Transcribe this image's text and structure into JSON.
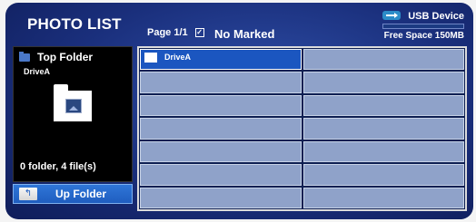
{
  "header": {
    "title": "PHOTO LIST",
    "page_info": "Page 1/1",
    "marked_text": "No Marked",
    "device_label": "USB Device",
    "free_space": "Free Space 150MB",
    "usage_fraction": 0.0
  },
  "left_panel": {
    "folder_title": "Top Folder",
    "drive_name": "DriveA",
    "file_count": "0 folder, 4 file(s)",
    "up_folder_label": "Up Folder",
    "icons": [
      "folder-small-icon",
      "big-folder-icon",
      "up-arrow-icon"
    ]
  },
  "grid": {
    "rows": 7,
    "columns": 2,
    "items": [
      {
        "label": "DriveA",
        "selected": true
      },
      {
        "label": "",
        "selected": false
      },
      {
        "label": "",
        "selected": false
      },
      {
        "label": "",
        "selected": false
      },
      {
        "label": "",
        "selected": false
      },
      {
        "label": "",
        "selected": false
      },
      {
        "label": "",
        "selected": false
      },
      {
        "label": "",
        "selected": false
      },
      {
        "label": "",
        "selected": false
      },
      {
        "label": "",
        "selected": false
      },
      {
        "label": "",
        "selected": false
      },
      {
        "label": "",
        "selected": false
      },
      {
        "label": "",
        "selected": false
      },
      {
        "label": "",
        "selected": false
      }
    ]
  },
  "colors": {
    "background": "#1a2f7c",
    "selected_cell": "#1b56c0",
    "cell": "#8fa2c9",
    "usb_accent": "#2fb3ec"
  }
}
